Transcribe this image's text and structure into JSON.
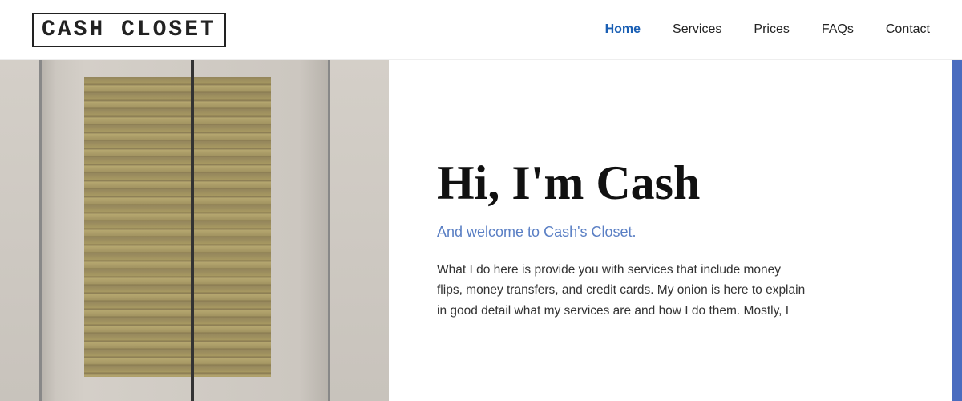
{
  "site": {
    "logo": "CASH CLOSET"
  },
  "nav": {
    "items": [
      {
        "label": "Home",
        "active": true
      },
      {
        "label": "Services",
        "active": false
      },
      {
        "label": "Prices",
        "active": false
      },
      {
        "label": "FAQs",
        "active": false
      },
      {
        "label": "Contact",
        "active": false
      }
    ]
  },
  "hero": {
    "title": "Hi, I'm Cash",
    "subtitle": "And welcome to Cash's Closet.",
    "body": "What I do here is provide you with services that include money flips, money transfers, and credit cards. My onion is here to explain in good detail what my services are and how I do them. Mostly, I"
  },
  "colors": {
    "nav_active": "#1a5fb4",
    "subtitle": "#5a7fc4",
    "scrollbar": "#4a6cbf"
  }
}
